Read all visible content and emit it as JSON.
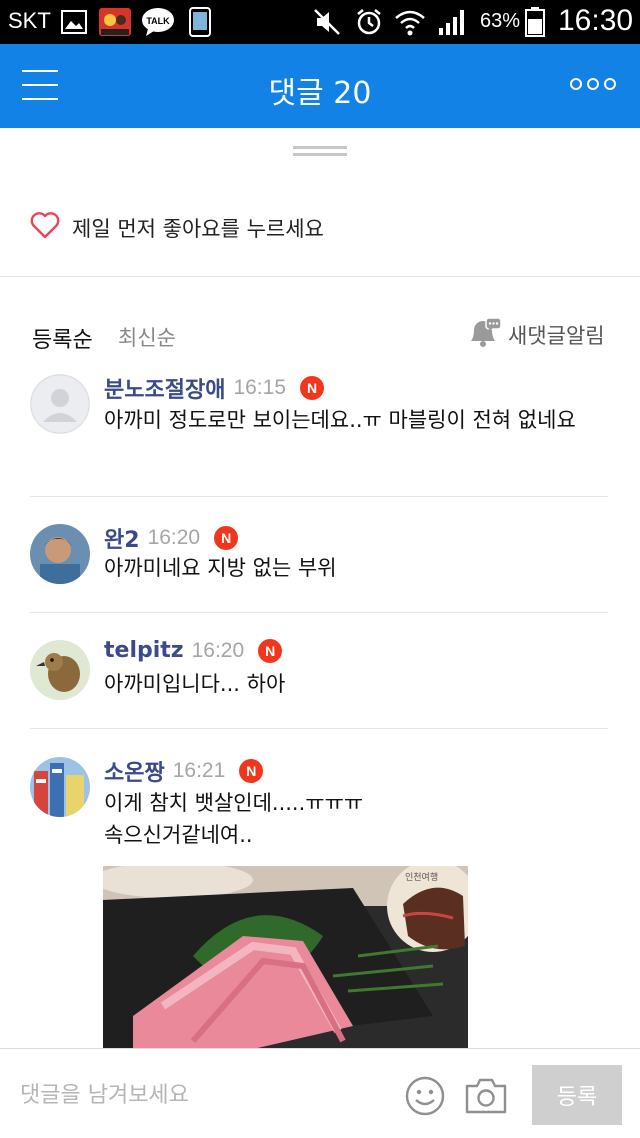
{
  "status_bar": {
    "carrier": "SKT",
    "battery_percent": "63%",
    "time": "16:30",
    "icons": [
      "gallery-icon",
      "game-app-icon",
      "talk-icon",
      "phone-icon",
      "mute-icon",
      "alarm-icon",
      "wifi-icon",
      "signal-icon",
      "battery-icon"
    ],
    "talk_label": "TALK"
  },
  "header": {
    "title": "댓글 20",
    "menu_icon": "hamburger-menu-icon",
    "more_icon": "more-options-icon"
  },
  "like": {
    "text": "제일 먼저 좋아요를 누르세요",
    "icon": "heart-outline-icon",
    "color": "#e8455a"
  },
  "sort": {
    "active": "등록순",
    "inactive": "최신순",
    "notify_label": "새댓글알림",
    "notify_icon": "bell-comment-icon"
  },
  "comments": [
    {
      "author": "분노조절장애",
      "time": "16:15",
      "badge": "N",
      "body": "아까미 정도로만 보이는데요..ㅠ 마블링이 전혀 없네요",
      "avatar": "default-avatar"
    },
    {
      "author": "완2",
      "time": "16:20",
      "badge": "N",
      "body": "아까미네요 지방 없는 부위",
      "avatar": "photo-avatar"
    },
    {
      "author": "telpitz",
      "time": "16:20",
      "badge": "N",
      "body": "아까미입니다... 하아",
      "avatar": "bird-avatar"
    },
    {
      "author": "소온짱",
      "time": "16:21",
      "badge": "N",
      "body": "이게 참치 뱃살인데.....ㅠㅠㅠ\n속으신거같네여..",
      "avatar": "city-avatar",
      "photo_watermark": "인천여행"
    }
  ],
  "input": {
    "placeholder": "댓글을 남겨보세요",
    "emoji_icon": "emoji-icon",
    "camera_icon": "camera-icon",
    "submit_label": "등록"
  },
  "colors": {
    "header_bg": "#1282e6",
    "author": "#3b4a8a",
    "badge": "#f0361c",
    "submit_bg": "#cfcfcf"
  }
}
